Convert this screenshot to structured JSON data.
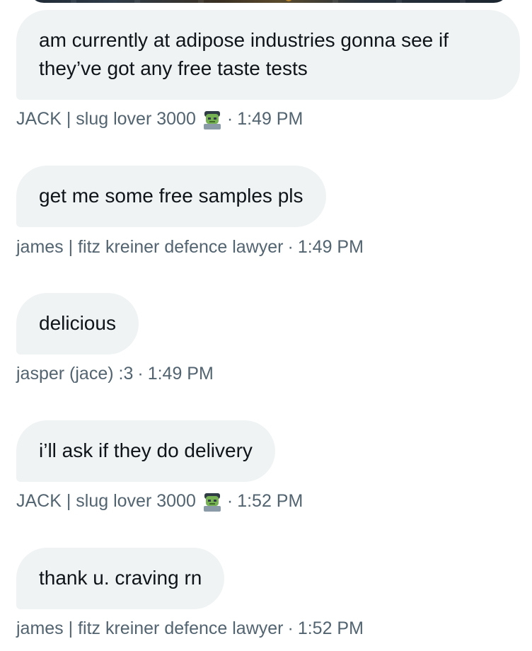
{
  "messages": [
    {
      "text": "am currently at adipose industries gonna see if they’ve got any free taste tests",
      "sender": "JACK | slug lover 3000",
      "emoji": "zombie-icon",
      "time": "1:49 PM"
    },
    {
      "text": "get me some free samples pls",
      "sender": "james | fitz kreiner defence lawyer",
      "time": "1:49 PM"
    },
    {
      "text": "delicious",
      "sender": "jasper (jace) :3",
      "time": "1:49 PM"
    },
    {
      "text": "i’ll ask if they do delivery",
      "sender": "JACK | slug lover 3000",
      "emoji": "zombie-icon",
      "time": "1:52 PM"
    },
    {
      "text": "thank u. craving rn",
      "sender": "james | fitz kreiner defence lawyer",
      "time": "1:52 PM"
    }
  ],
  "separator": "·",
  "colors": {
    "bubble": "#eff3f4",
    "text": "#0f1419",
    "meta": "#536471"
  }
}
